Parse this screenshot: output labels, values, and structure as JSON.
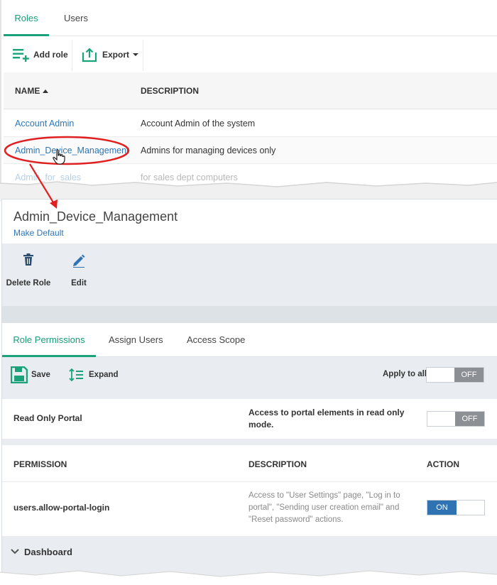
{
  "top_tabs": [
    {
      "label": "Roles",
      "active": true
    },
    {
      "label": "Users",
      "active": false
    }
  ],
  "toolbar": {
    "add_role": "Add role",
    "export": "Export"
  },
  "roles_table": {
    "headers": {
      "name": "NAME",
      "description": "DESCRIPTION"
    },
    "rows": [
      {
        "name": "Account Admin",
        "description": "Account Admin of the system"
      },
      {
        "name": "Admin_Device_Management",
        "description": "Admins for managing devices only"
      },
      {
        "name": "Admin_for_sales",
        "description": "for sales dept computers"
      }
    ]
  },
  "detail": {
    "title": "Admin_Device_Management",
    "make_default": "Make Default",
    "actions": {
      "delete": "Delete Role",
      "edit": "Edit"
    }
  },
  "perm_tabs": [
    {
      "label": "Role Permissions",
      "active": true
    },
    {
      "label": "Assign Users",
      "active": false
    },
    {
      "label": "Access Scope",
      "active": false
    }
  ],
  "perm_toolbar": {
    "save": "Save",
    "expand": "Expand",
    "apply_to_all": "Apply to all",
    "apply_state": "OFF"
  },
  "read_only": {
    "label": "Read Only Portal",
    "description": "Access to portal elements in read only mode.",
    "state": "OFF"
  },
  "perm_table": {
    "headers": {
      "permission": "PERMISSION",
      "description": "DESCRIPTION",
      "action": "ACTION"
    },
    "row": {
      "permission": "users.allow-portal-login",
      "description": "Access to \"User Settings\" page, \"Log in to portal\", \"Sending user creation email\" and \"Reset password\" actions.",
      "state": "ON"
    }
  },
  "section": {
    "label": "Dashboard"
  },
  "colors": {
    "accent": "#1aa37a",
    "link": "#2f76b4",
    "toggle_on": "#2f73b3",
    "toggle_off": "#8c8f93",
    "callout": "#e02020"
  }
}
